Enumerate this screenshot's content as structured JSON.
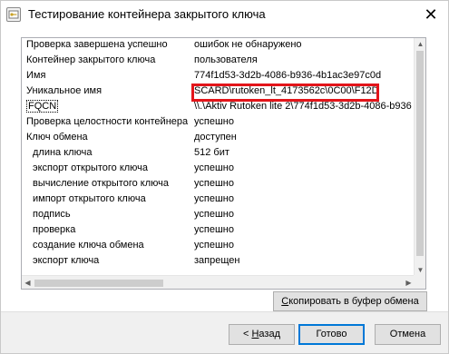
{
  "window": {
    "title": "Тестирование контейнера закрытого ключа",
    "close_glyph": "✕"
  },
  "list": {
    "rows": [
      {
        "name": "Проверка завершена успешно",
        "value": "ошибок не обнаружено",
        "indent": false
      },
      {
        "name": "Контейнер закрытого ключа",
        "value": "пользователя",
        "indent": false
      },
      {
        "name": "Имя",
        "value": "774f1d53-3d2b-4086-b936-4b1ac3e97c0d",
        "indent": false
      },
      {
        "name": "Уникальное имя",
        "value": "SCARD\\rutoken_lt_4173562c\\0C00\\F12D",
        "indent": false
      },
      {
        "name": "FQCN",
        "value": "\\\\.\\Aktiv Rutoken lite 2\\774f1d53-3d2b-4086-b936",
        "indent": false
      },
      {
        "name": "Проверка целостности контейнера",
        "value": "успешно",
        "indent": false
      },
      {
        "name": "Ключ обмена",
        "value": "доступен",
        "indent": false
      },
      {
        "name": "длина ключа",
        "value": "512 бит",
        "indent": true
      },
      {
        "name": "экспорт открытого ключа",
        "value": "успешно",
        "indent": true
      },
      {
        "name": "вычисление открытого ключа",
        "value": "успешно",
        "indent": true
      },
      {
        "name": "импорт открытого ключа",
        "value": "успешно",
        "indent": true
      },
      {
        "name": "подпись",
        "value": "успешно",
        "indent": true
      },
      {
        "name": "проверка",
        "value": "успешно",
        "indent": true
      },
      {
        "name": "создание ключа обмена",
        "value": "успешно",
        "indent": true
      },
      {
        "name": "экспорт ключа",
        "value": "запрещен",
        "indent": true
      }
    ],
    "highlight_color": "#e3151a"
  },
  "buttons": {
    "copy_prefix": "С",
    "copy_rest": "копировать в буфер обмена",
    "back_prefix": "< ",
    "back_hot": "Н",
    "back_rest": "азад",
    "ok": "Готово",
    "cancel": "Отмена"
  }
}
